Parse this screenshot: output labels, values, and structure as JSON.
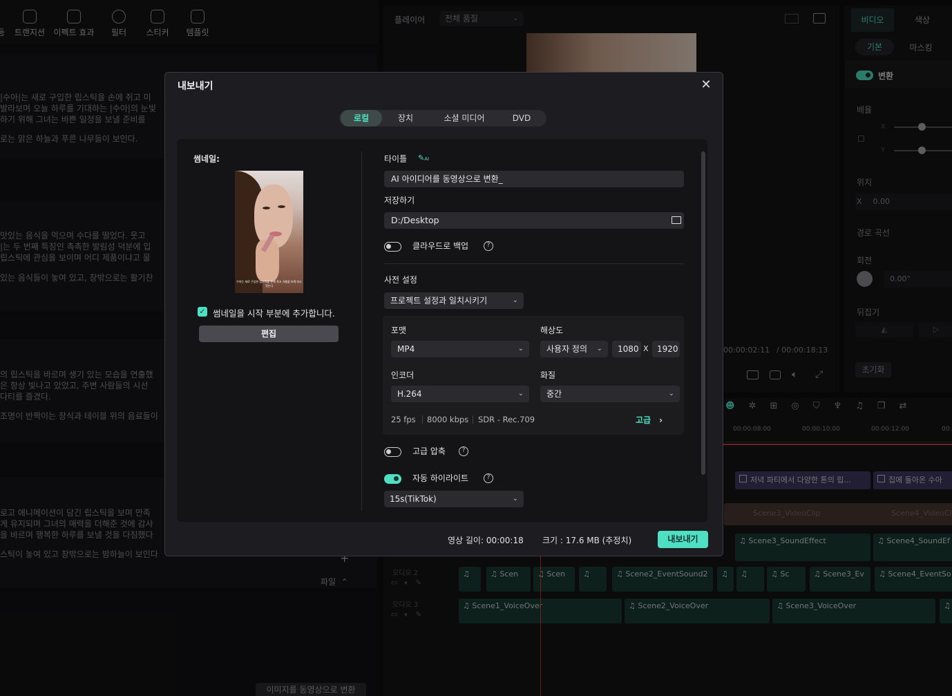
{
  "toolbar": {
    "items": [
      "트랜지션",
      "이펙트 효과",
      "필터",
      "스티커",
      "템플릿"
    ],
    "left_fragment": "등"
  },
  "story": [
    "|수아|는 새로 구입한 립스틱을 손에 쥐고 미",
    "발라보며 오늘 하루를 기대하는 |수아|의 눈빛",
    "하기 위해 그녀는 바쁜 일정을 보낼 준비를 ",
    "로는 맑은 하늘과 푸른 나무들이 보인다.",
    "맛있는 음식을 먹으며 수다를 떨었다. 웃고 ",
    "|는 두 번째 특징인 촉촉한 발림성 덕분에 입",
    "립스틱에 관심을 보이며 어디 제품이냐고 물",
    "있는 음식들이 놓여 있고, 창밖으로는 활기찬",
    "의 립스틱을 바르며 생기 있는 모습을 연출했",
    "은 항상 빛나고 있었고, 주변 사람들의 시선",
    "다티를 즐겼다.",
    "조명이 반짝이는 장식과 테이블 위의 음료들이",
    "로고 애니메이션이 담긴 립스틱을 보며 만족",
    "게 유지되며 그녀의 매력을 더해준 것에 감사",
    "을 바르며 행복한 하루를 보낼 것을 다짐했다",
    "스틱이 놓여 있고 창밖으로는 밤하늘이 보인다"
  ],
  "left_bottom": {
    "file_label": "파일",
    "convert_button": "이미지를 동영상으로 변환"
  },
  "player": {
    "label": "플레이어",
    "quality": "전체 품질",
    "time_current": "00:00:02:11",
    "time_total": "/ 00:00:18:13"
  },
  "inspector": {
    "tabs": [
      "비디오",
      "색상"
    ],
    "subtabs": [
      "기본",
      "마스킹"
    ],
    "transform": "변환",
    "scale": "배율",
    "x": "X",
    "y": "Y",
    "position": "위치",
    "pos_x_value": "0.00",
    "path_curve": "경로 곡선",
    "rotation": "회전",
    "rotation_value": "0.00°",
    "flip": "뒤집기",
    "reset": "초기화"
  },
  "timeline": {
    "ruler": [
      "00:00:08:00",
      "00:00:10:00",
      "00:00:12:00",
      "00:"
    ],
    "title_clips": [
      "저녁 파티에서 다양한 톤의 립...",
      "집에 돌아온 수아"
    ],
    "video_clips": [
      "Scene3_VideoClip",
      "Scene4_VideoCl"
    ],
    "sound_clips": [
      "Scene3_SoundEffect",
      "Scene4_SoundEf"
    ],
    "audio2_label": "오디오 2",
    "audio3_label": "오디오 3",
    "event_clips": [
      "Scen",
      "Scen",
      "Scene2_EventSound2",
      "Sc",
      "Scene3_Ev",
      "Scene4_EventSo"
    ],
    "voice_clips": [
      "Scene1_VoiceOver",
      "Scene2_VoiceOver",
      "Scene3_VoiceOver"
    ]
  },
  "dialog": {
    "title": "내보내기",
    "tabs": [
      "로컬",
      "장치",
      "소셜 미디어",
      "DVD"
    ],
    "active_tab": 0,
    "thumbnail_label": "썸네일:",
    "thumbnail_caption": "수아는 새로 구입한 립스틱을 손에 쥐고 거울을 보며 미소 짓는다",
    "thumbnail_checkbox": "썸네일을 시작 부분에 추가합니다.",
    "edit_button": "편집",
    "title_label": "타이틀",
    "title_ai_badge": "AI",
    "title_value": "AI 아이디어를 동영상으로 변환_",
    "save_label": "저장하기",
    "save_path": "D:/Desktop",
    "cloud_backup": "클라우드로 백업",
    "preset_label": "사전 설정",
    "preset_value": "프로젝트 설정과 일치시키기",
    "format_label": "포맷",
    "format_value": "MP4",
    "resolution_label": "해상도",
    "resolution_mode": "사용자 정의",
    "res_width": "1080",
    "res_x": "X",
    "res_height": "1920",
    "encoder_label": "인코더",
    "encoder_value": "H.264",
    "quality_label": "화질",
    "quality_value": "중간",
    "spec_fps": "25 fps",
    "spec_bitrate": "8000 kbps",
    "spec_color": "SDR - Rec.709",
    "advanced_link": "고급",
    "advanced_compress": "고급 압축",
    "auto_highlight": "자동 하이라이트",
    "highlight_value": "15s(TikTok)",
    "duration_text": "영상 길이: 00:00:18",
    "size_text": "크기 :  17.6 MB (추정치)",
    "export_button": "내보내기",
    "toggles": {
      "cloud_backup": false,
      "advanced_compress": false,
      "auto_highlight": true
    },
    "thumbnail_checked": true
  },
  "colors": {
    "accent": "#4fe0c3",
    "dialog_bg": "#1d1d21",
    "panel_bg": "#141416"
  }
}
